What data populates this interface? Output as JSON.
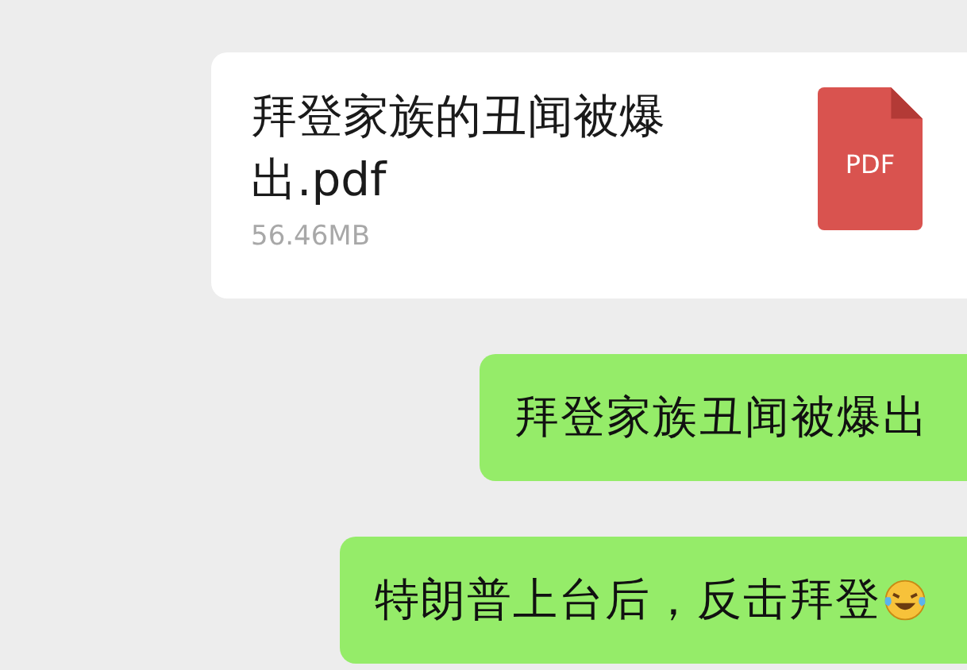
{
  "messages": [
    {
      "kind": "file",
      "file_name": "拜登家族的丑闻被爆出.pdf",
      "file_size": "56.46MB",
      "file_type": "PDF"
    },
    {
      "kind": "text",
      "text": "拜登家族丑闻被爆出",
      "emoji": false
    },
    {
      "kind": "text",
      "text": "特朗普上台后，反击拜登",
      "emoji": true
    }
  ]
}
